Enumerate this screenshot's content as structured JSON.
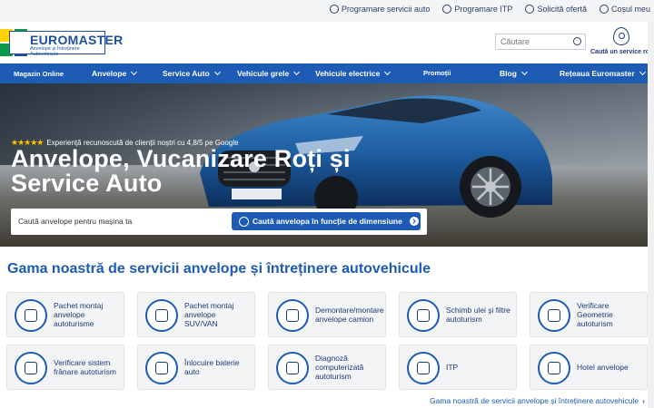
{
  "topbar": {
    "links": [
      {
        "label": "Programare servicii auto",
        "icon": "calendar-icon"
      },
      {
        "label": "Programare ITP",
        "icon": "car-check-icon"
      },
      {
        "label": "Solicită ofertă",
        "icon": "quote-icon"
      },
      {
        "label": "Coșul meu",
        "icon": "cart-icon"
      }
    ]
  },
  "header": {
    "logo_name": "EUROMASTER",
    "logo_tagline": "Anvelope și Întreținere Autovehicule",
    "search_placeholder": "Căutare",
    "locator_label": "Caută un service roți"
  },
  "nav": {
    "items": [
      {
        "label": "Magazin Online",
        "dropdown": false
      },
      {
        "label": "Anvelope",
        "dropdown": true
      },
      {
        "label": "Service Auto",
        "dropdown": true
      },
      {
        "label": "Vehicule grele",
        "dropdown": true
      },
      {
        "label": "Vehicule electrice",
        "dropdown": true
      },
      {
        "label": "Promoții",
        "dropdown": false
      },
      {
        "label": "Blog",
        "dropdown": true
      },
      {
        "label": "Rețeaua Euromaster",
        "dropdown": true
      }
    ]
  },
  "hero": {
    "rating_stars": "★★★★★",
    "rating_text": "Experiență recunoscută de clienții noștri cu 4,8/5 pe Google",
    "title": "Anvelope, Vucanizare Roți și Service Auto",
    "search_label": "Caută anvelope pentru mașina ta",
    "search_button": "Caută anvelopa în funcție de dimensiune"
  },
  "services": {
    "title": "Gama noastră de servicii anvelope și întreținere autovehicule",
    "cards": [
      {
        "label": "Pachet montaj anvelope autoturisme",
        "icon": "tire-mount-icon"
      },
      {
        "label": "Pachet montaj anvelope SUV/VAN",
        "icon": "suv-tire-icon"
      },
      {
        "label": "Demontare/montare anvelope camion",
        "icon": "truck-tire-icon"
      },
      {
        "label": "Schimb ulei și filtre autoturism",
        "icon": "oil-change-icon"
      },
      {
        "label": "Verificare Geometrie autoturism",
        "icon": "alignment-icon"
      },
      {
        "label": "Verificare sistem frânare autoturism",
        "icon": "brake-icon"
      },
      {
        "label": "Înlocuire baterie auto",
        "icon": "battery-icon"
      },
      {
        "label": "Diagnoză computerizată autoturism",
        "icon": "diagnostics-icon"
      },
      {
        "label": "ITP",
        "icon": "itp-icon"
      },
      {
        "label": "Hotel anvelope",
        "icon": "tire-hotel-icon"
      }
    ],
    "more_link": "Gama noastră de servicii anvelope și întreținere autovehicule"
  },
  "colors": {
    "brand_blue": "#1d5bb5",
    "dark_blue": "#1b3a78",
    "star": "#ffc400"
  }
}
